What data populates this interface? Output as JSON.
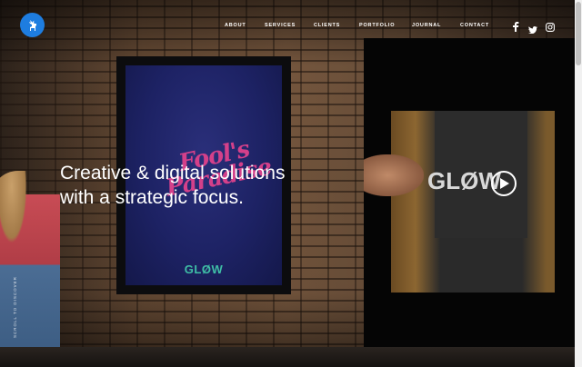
{
  "brand": {
    "logo_icon": "deer-icon",
    "accent": "#1e7de0"
  },
  "nav": {
    "items": [
      {
        "label": "ABOUT"
      },
      {
        "label": "SERVICES"
      },
      {
        "label": "CLIENTS"
      },
      {
        "label": "PORTFOLIO"
      },
      {
        "label": "JOURNAL"
      },
      {
        "label": "CONTACT"
      }
    ]
  },
  "social": {
    "icons": [
      "facebook-icon",
      "twitter-icon",
      "instagram-icon"
    ]
  },
  "hero": {
    "headline": "Creative & digital solutions\nwith a strategic focus.",
    "poster_script": "Fool's Paradise",
    "poster_logo": "GLØW",
    "video_logo": "GLØW",
    "scroll_label": "SCROLL TO DISCOVER"
  }
}
